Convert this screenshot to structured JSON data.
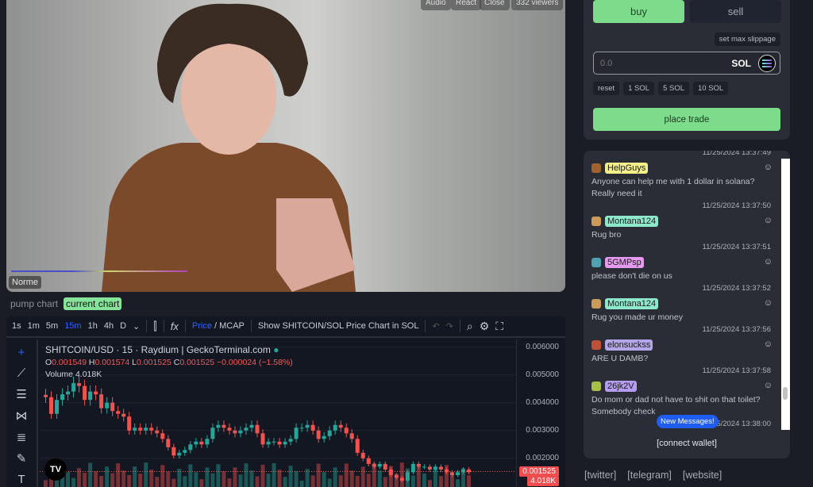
{
  "video": {
    "buttons": [
      "Audio",
      "React",
      "Close"
    ],
    "viewers": "332 viewers",
    "streamer": "Norme"
  },
  "chart_tabs": [
    {
      "label": "pump chart",
      "active": false
    },
    {
      "label": "current chart",
      "active": true
    }
  ],
  "toolbar": {
    "intervals": [
      "1s",
      "1m",
      "5m",
      "15m",
      "1h",
      "4h",
      "D"
    ],
    "selected_interval": "15m",
    "price": "Price",
    "mcap": "/ MCAP",
    "show_sol": "Show SHITCOIN/SOL Price Chart in SOL"
  },
  "chart_legend": {
    "title": "SHITCOIN/USD · 15 · Raydium | GeckoTerminal.com",
    "o": "0.001549",
    "h": "0.001574",
    "l": "0.001525",
    "c": "0.001525",
    "change": "−0.000024 (−1.58%)",
    "volume_label": "Volume",
    "volume": "4.018K"
  },
  "chart_data": {
    "type": "candlestick",
    "y_ticks": [
      "0.006000",
      "0.005000",
      "0.004000",
      "0.003000",
      "0.002000"
    ],
    "ylim": [
      0.0008,
      0.0061
    ],
    "last_price": "0.001525",
    "last_volume": "4.018K",
    "up_color": "#26a69a",
    "down_color": "#ef5350",
    "closes": [
      0.0042,
      0.0036,
      0.0041,
      0.0043,
      0.0044,
      0.0047,
      0.0046,
      0.0041,
      0.0044,
      0.0043,
      0.0038,
      0.004,
      0.0037,
      0.0036,
      0.0035,
      0.003,
      0.0031,
      0.003,
      0.0031,
      0.003,
      0.0029,
      0.0027,
      0.0024,
      0.0021,
      0.0022,
      0.0023,
      0.0025,
      0.0026,
      0.0025,
      0.0027,
      0.0031,
      0.0032,
      0.0031,
      0.003,
      0.0029,
      0.003,
      0.0031,
      0.0032,
      0.0029,
      0.0025,
      0.0026,
      0.0026,
      0.0025,
      0.0026,
      0.0027,
      0.0031,
      0.0031,
      0.0032,
      0.003,
      0.0027,
      0.0028,
      0.003,
      0.0032,
      0.0031,
      0.0029,
      0.0027,
      0.0022,
      0.002,
      0.0018,
      0.0017,
      0.0018,
      0.0016,
      0.0014,
      0.0013,
      0.0012,
      0.0015,
      0.0018,
      0.0017,
      0.0017,
      0.0016,
      0.0017,
      0.0016,
      0.0015,
      0.0014,
      0.0015,
      0.0016,
      0.0015
    ]
  },
  "trade": {
    "buy": "buy",
    "sell": "sell",
    "slippage": "set max slippage",
    "amount_placeholder": "0.0",
    "currency": "SOL",
    "quick": [
      "reset",
      "1 SOL",
      "5 SOL",
      "10 SOL"
    ],
    "place": "place trade"
  },
  "chat": {
    "top_timestamp": "11/25/2024 13:37:49",
    "messages": [
      {
        "user": "HelpGuys",
        "color": "#f3f08a",
        "avatar": "#a0622e",
        "text": "Anyone can help me with 1 dollar in solana? Really need it",
        "time": "11/25/2024 13:37:50"
      },
      {
        "user": "Montana124",
        "color": "#8ee8cc",
        "avatar": "#c99a5a",
        "text": "Rug bro",
        "time": "11/25/2024 13:37:51"
      },
      {
        "user": "5GMPsp",
        "color": "#e59af0",
        "avatar": "#4fa0b0",
        "text": "please don't die on us",
        "time": "11/25/2024 13:37:52"
      },
      {
        "user": "Montana124",
        "color": "#8ee8cc",
        "avatar": "#c99a5a",
        "text": "Rug you made ur money",
        "time": "11/25/2024 13:37:56"
      },
      {
        "user": "elonsuckss",
        "color": "#b3a6e8",
        "avatar": "#c0503a",
        "text": "ARE U DAMB?",
        "time": "11/25/2024 13:37:58"
      },
      {
        "user": "26jk2V",
        "color": "#b49cf0",
        "avatar": "#a8c04a",
        "text": "Do mom or dad not have to shit on that toilet? Somebody check",
        "time": "11/25/2024 13:38:00"
      }
    ],
    "new_messages": "New Messages!",
    "connect": "[connect wallet]"
  },
  "links": [
    "[twitter]",
    "[telegram]",
    "[website]"
  ]
}
